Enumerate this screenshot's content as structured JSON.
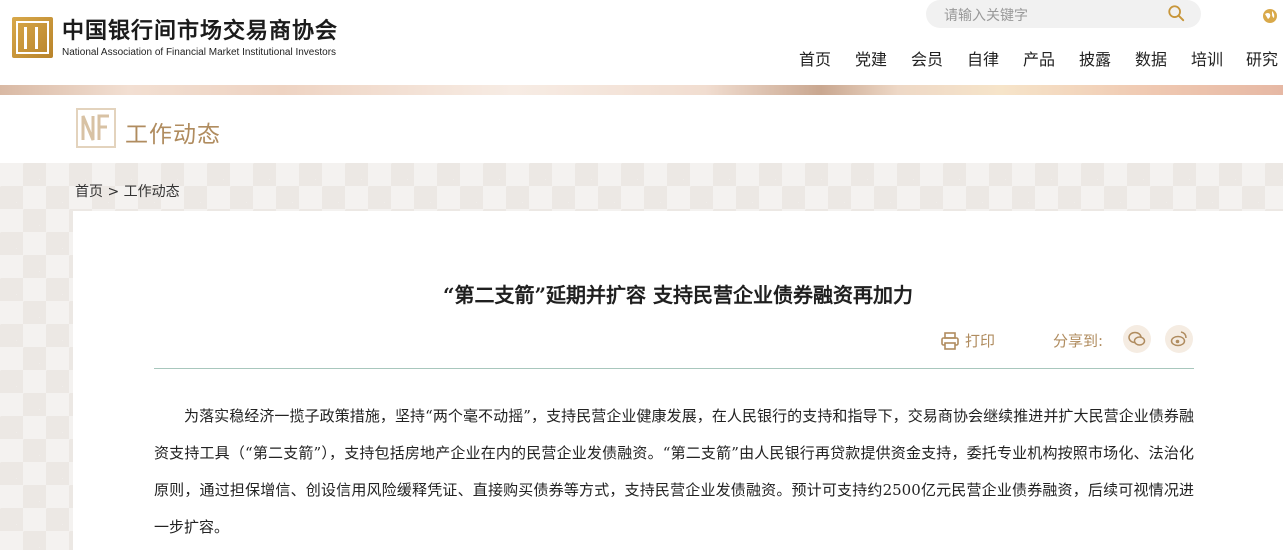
{
  "header": {
    "org_name_cn": "中国银行间市场交易商协会",
    "org_name_en": "National Association of Financial Market Institutional Investors",
    "search_placeholder": "请输入关键字",
    "nav": [
      "首页",
      "党建",
      "会员",
      "自律",
      "产品",
      "披露",
      "数据",
      "培训",
      "研究"
    ]
  },
  "section": {
    "title": "工作动态"
  },
  "breadcrumb": "首页 > 工作动态",
  "article": {
    "title": "“第二支箭”延期并扩容 支持民营企业债券融资再加力",
    "print_label": "打印",
    "share_label": "分享到:",
    "body": "为落实稳经济一揽子政策措施，坚持“两个毫不动摇”，支持民营企业健康发展，在人民银行的支持和指导下，交易商协会继续推进并扩大民营企业债券融资支持工具（“第二支箭”），支持包括房地产企业在内的民营企业发债融资。“第二支箭”由人民银行再贷款提供资金支持，委托专业机构按照市场化、法治化原则，通过担保增信、创设信用风险缓释凭证、直接购买债券等方式，支持民营企业发债融资。预计可支持约2500亿元民营企业债券融资，后续可视情况进一步扩容。"
  },
  "icons": {
    "search": "search-icon",
    "globe": "globe-icon",
    "print": "printer-icon",
    "wechat": "wechat-icon",
    "weibo": "weibo-icon"
  },
  "colors": {
    "accent": "#b08c5f",
    "logo_gold": "#c8963a",
    "divider": "#a8c7bd"
  }
}
